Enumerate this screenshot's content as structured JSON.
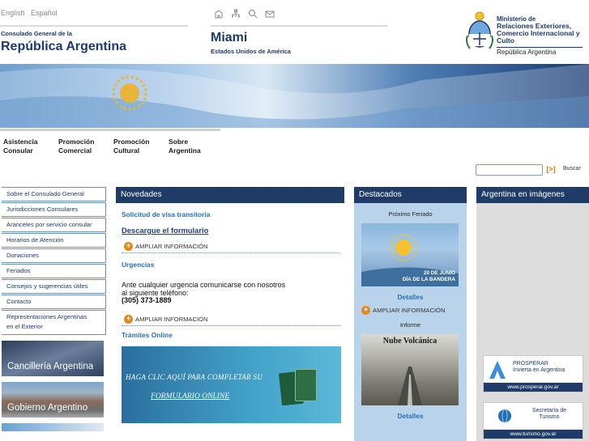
{
  "header": {
    "languages": [
      "English",
      "Español"
    ],
    "consulate_small": "Consulado General de la",
    "consulate_big": "República Argentina",
    "city": "Miami",
    "city_sub": "Estados Unidos de América",
    "ministry_lines": [
      "Ministerio de",
      "Relaciones Exteriores,",
      "Comercio Internacional y Culto"
    ],
    "ministry_country": "República Argentina",
    "icons": [
      "home-icon",
      "sitemap-icon",
      "search-icon",
      "mail-icon"
    ]
  },
  "topnav": [
    {
      "line1": "Asistencia",
      "line2": "Consular"
    },
    {
      "line1": "Promoción",
      "line2": "Comercial"
    },
    {
      "line1": "Promoción",
      "line2": "Cultural"
    },
    {
      "line1": "Sobre",
      "line2": "Argentina"
    }
  ],
  "search": {
    "go_label": "[>]",
    "button_label": "Buscar"
  },
  "sidebar": {
    "items": [
      "Sobre el Consulado General",
      "Jurisdicciones Consulares",
      "Aranceles por servicio consular",
      "Horarios de Atención",
      "Donaciones",
      "Feriados",
      "Consejos y sugerencias útiles",
      "Contacto"
    ],
    "item_tall_line1": "Representaciones Argentinas",
    "item_tall_line2": "en el Exterior",
    "images": [
      "Cancillería Argentina",
      "Gobierno Argentino"
    ]
  },
  "novedades": {
    "title": "Novedades",
    "sub1": "Solicitud de visa transitoria",
    "link": "Descargue el formulario",
    "ampliar": "AMPLIAR INFORMACIÓN",
    "sub2": "Urgencias",
    "text_line1": "Ante cualquier urgencia comunicarse con nosotros",
    "text_line2": "al siguiente teléfono:",
    "phone": "(305) 373-1889",
    "sub3": "Trámites Online",
    "banner_line1": "HAGA CLIC AQUÍ PARA COMPLETAR SU",
    "banner_line2": "FORMULARIO ONLINE"
  },
  "destacados": {
    "title": "Destacados",
    "label1": "Próximo Feriado",
    "img1_line1": "20 DE JUNIO",
    "img1_line2": "DÍA DE LA BANDERA",
    "detalles": "Detalles",
    "ampliar": "AMPLIAR INFORMACIÓN",
    "label2": "Informe",
    "img2_caption": "Nube Volcánica"
  },
  "imagenes": {
    "title": "Argentina en imágenes",
    "promo1_line1": "PROSPERAR",
    "promo1_line2": "Invierta en Argentina",
    "promo1_url": "www.prosperar.gov.ar",
    "promo2_line1": "Secretaría de",
    "promo2_line2": "Turismo",
    "promo2_url": "www.turismo.gov.ar"
  },
  "colors": {
    "navy": "#1f3c68",
    "link_blue": "#2a6fb7",
    "orange": "#e8861a",
    "light_blue_panel": "#b9d4ea"
  }
}
